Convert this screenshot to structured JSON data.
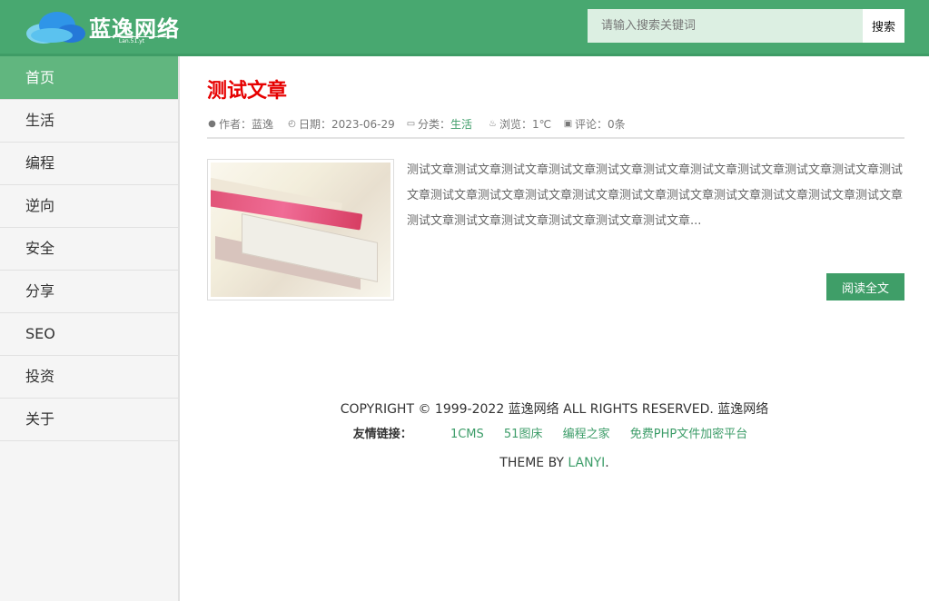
{
  "header": {
    "logo_text": "蓝逸网络",
    "logo_subtext": "Lan.51.yt",
    "search_placeholder": "请输入搜索关键词",
    "search_button": "搜索",
    "colors": {
      "brand_green": "#48a870",
      "accent_green": "#3f9e68",
      "search_background": "#dcefe2"
    }
  },
  "sidebar": {
    "items": [
      {
        "label": "首页",
        "active": true
      },
      {
        "label": "生活"
      },
      {
        "label": "编程"
      },
      {
        "label": "逆向"
      },
      {
        "label": "安全"
      },
      {
        "label": "分享"
      },
      {
        "label": "SEO"
      },
      {
        "label": "投资"
      },
      {
        "label": "关于"
      }
    ]
  },
  "article": {
    "title": "测试文章",
    "meta": {
      "author": "作者：蓝逸",
      "date": "日期：2023-06-29",
      "category_label": "分类：",
      "category_value": "生活",
      "views": "浏览：1℃",
      "comments": "评论：0条"
    },
    "excerpt": "测试文章测试文章测试文章测试文章测试文章测试文章测试文章测试文章测试文章测试文章测试文章测试文章测试文章测试文章测试文章测试文章测试文章测试文章测试文章测试文章测试文章测试文章测试文章测试文章测试文章测试文章测试文章...",
    "read_more": "阅读全文",
    "image_icon": "book-photo-image"
  },
  "footer": {
    "copyright": "COPYRIGHT © 1999-2022 蓝逸网络 ALL RIGHTS RESERVED. 蓝逸网络",
    "links_label": "友情链接：",
    "links": [
      "1CMS",
      "51图床",
      "编程之家",
      "免费PHP文件加密平台"
    ],
    "theme_prefix": "THEME BY ",
    "theme_name": "LANYI",
    "theme_suffix": "."
  }
}
